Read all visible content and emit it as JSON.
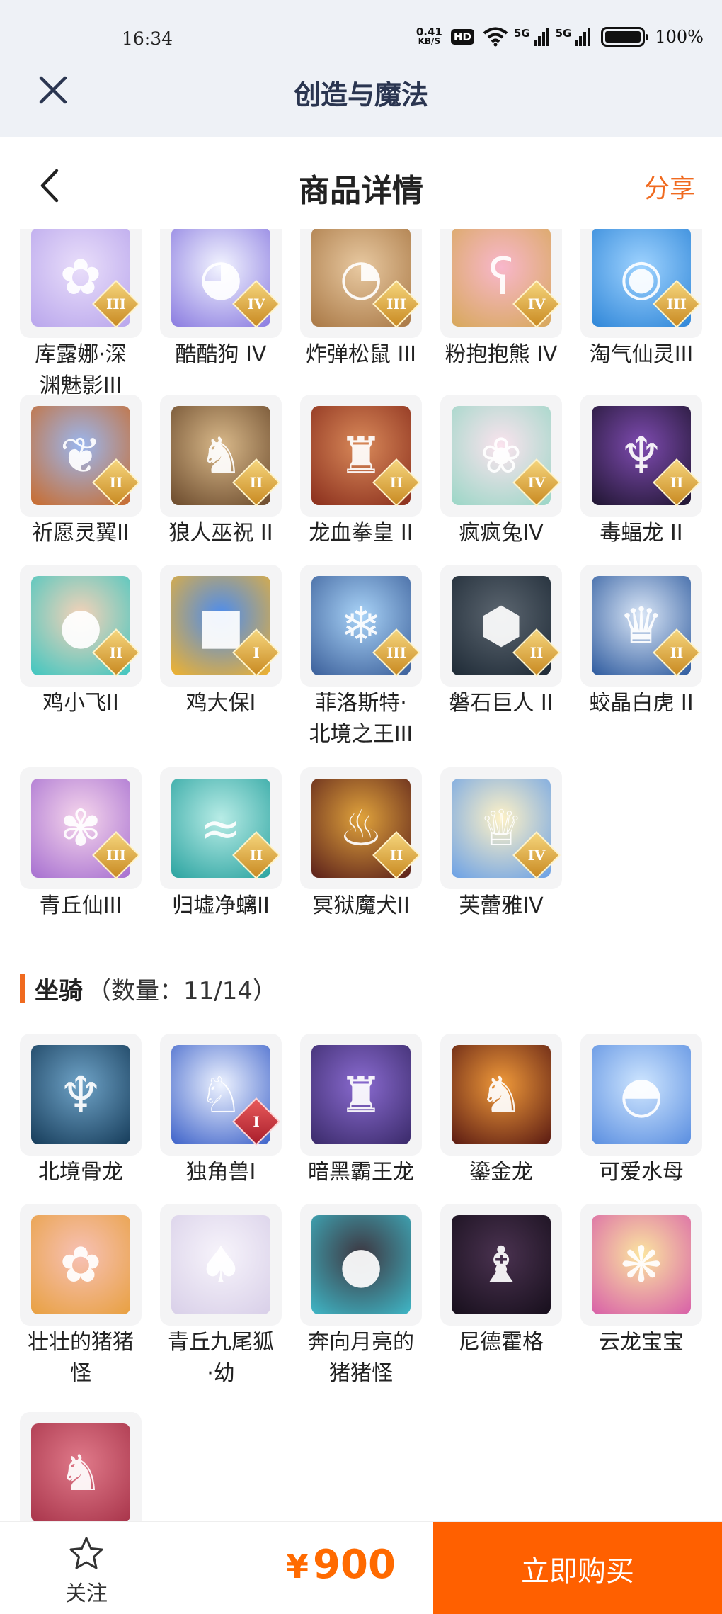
{
  "status_bar": {
    "time": "16:34",
    "net_speed": "0.41",
    "net_speed_unit": "KB/S",
    "hd_badge": "HD",
    "network_1": "5G",
    "network_2": "5G",
    "battery_percent": "100%",
    "battery_level": 1.0
  },
  "app_header": {
    "title": "创造与魔法",
    "close_icon": "close-icon"
  },
  "page_header": {
    "title": "商品详情",
    "share_label": "分享",
    "back_icon": "chevron-left-icon"
  },
  "pets": [
    {
      "name": "库露娜·深\n渊魅影III",
      "rank": "III",
      "colors": [
        "#e9defa",
        "#b9a6ec"
      ],
      "glyph": "✿"
    },
    {
      "name": "酷酷狗 IV",
      "rank": "IV",
      "colors": [
        "#f3f5ff",
        "#8a7be0"
      ],
      "glyph": "◕"
    },
    {
      "name": "炸弹松鼠 III",
      "rank": "III",
      "colors": [
        "#e8c9a1",
        "#a97845"
      ],
      "glyph": "◔"
    },
    {
      "name": "粉抱抱熊 IV",
      "rank": "IV",
      "colors": [
        "#f8b7cc",
        "#d7a85a"
      ],
      "glyph": "ʕ"
    },
    {
      "name": "淘气仙灵III",
      "rank": "III",
      "colors": [
        "#9fd3ff",
        "#2f86d8"
      ],
      "glyph": "◉"
    },
    {
      "name": "祈愿灵翼II",
      "rank": "II",
      "colors": [
        "#9ab7f0",
        "#c96b2c"
      ],
      "glyph": "❦"
    },
    {
      "name": "狼人巫祝 II",
      "rank": "II",
      "colors": [
        "#d9b98a",
        "#6b4a2c"
      ],
      "glyph": "♞"
    },
    {
      "name": "龙血拳皇 II",
      "rank": "II",
      "colors": [
        "#d98a5a",
        "#8a2e1c"
      ],
      "glyph": "♜"
    },
    {
      "name": "疯疯兔IV",
      "rank": "IV",
      "colors": [
        "#fbe3ee",
        "#9ad6c6"
      ],
      "glyph": "❀"
    },
    {
      "name": "毒蝠龙 II",
      "rank": "II",
      "colors": [
        "#7e4bb0",
        "#1f1530"
      ],
      "glyph": "♆"
    },
    {
      "name": "鸡小飞II",
      "rank": "II",
      "colors": [
        "#f6d2b8",
        "#3fc6c0"
      ],
      "glyph": "●"
    },
    {
      "name": "鸡大保I",
      "rank": "I",
      "colors": [
        "#4b8cf0",
        "#f1b22c"
      ],
      "glyph": "■"
    },
    {
      "name": "菲洛斯特·\n北境之王III",
      "rank": "III",
      "colors": [
        "#a9d3f7",
        "#3b5f9a"
      ],
      "glyph": "❄"
    },
    {
      "name": "磐石巨人 II",
      "rank": "II",
      "colors": [
        "#5c6670",
        "#1e2a36"
      ],
      "glyph": "⬢"
    },
    {
      "name": "蛟晶白虎 II",
      "rank": "II",
      "colors": [
        "#dbe7f7",
        "#2d5a9e"
      ],
      "glyph": "♛"
    },
    {
      "name": "青丘仙III",
      "rank": "III",
      "colors": [
        "#f6d6ec",
        "#a66fd0"
      ],
      "glyph": "✾"
    },
    {
      "name": "归墟净螭II",
      "rank": "II",
      "colors": [
        "#b8ece6",
        "#2aa3a0"
      ],
      "glyph": "≈"
    },
    {
      "name": "冥狱魔犬II",
      "rank": "II",
      "colors": [
        "#e0a33c",
        "#5a1f1a"
      ],
      "glyph": "♨"
    },
    {
      "name": "芙蕾雅IV",
      "rank": "IV",
      "colors": [
        "#fff2c6",
        "#6aa0e6"
      ],
      "glyph": "♕"
    }
  ],
  "mounts_section": {
    "title": "坐骑",
    "count_label": "（数量：11/14）"
  },
  "mounts": [
    {
      "name": "北境骨龙",
      "rank": "",
      "colors": [
        "#6fa3c7",
        "#163c5a"
      ],
      "glyph": "♆"
    },
    {
      "name": "独角兽I",
      "rank": "I",
      "colors": [
        "#eef3ff",
        "#3d62c9"
      ],
      "glyph": "♘",
      "rank_style": "red"
    },
    {
      "name": "暗黑霸王龙",
      "rank": "",
      "colors": [
        "#8a6bd0",
        "#3a2a6a"
      ],
      "glyph": "♜"
    },
    {
      "name": "鎏金龙",
      "rank": "",
      "colors": [
        "#f09a3a",
        "#5a1a12"
      ],
      "glyph": "♞"
    },
    {
      "name": "可爱水母",
      "rank": "",
      "colors": [
        "#cfe6ff",
        "#5a8ee0"
      ],
      "glyph": "◓"
    },
    {
      "name": "壮壮的猪猪\n怪",
      "rank": "",
      "colors": [
        "#f7c1b6",
        "#e8a040"
      ],
      "glyph": "✿"
    },
    {
      "name": "青丘九尾狐\n·幼",
      "rank": "",
      "colors": [
        "#f7f4fb",
        "#d8cfe8"
      ],
      "glyph": "♠"
    },
    {
      "name": "奔向月亮的\n猪猪怪",
      "rank": "",
      "colors": [
        "#3d3640",
        "#3fb7c7"
      ],
      "glyph": "●"
    },
    {
      "name": "尼德霍格",
      "rank": "",
      "colors": [
        "#4a3250",
        "#170f1c"
      ],
      "glyph": "♝"
    },
    {
      "name": "云龙宝宝",
      "rank": "",
      "colors": [
        "#fbe6a0",
        "#d85fa8"
      ],
      "glyph": "❋"
    },
    {
      "name": "",
      "rank": "",
      "colors": [
        "#e07a8a",
        "#a8344a"
      ],
      "glyph": "♞"
    }
  ],
  "bottom_bar": {
    "follow_label": "关注",
    "currency": "¥",
    "price": "900",
    "buy_label": "立即购买"
  },
  "colors": {
    "accent": "#f06a1f",
    "buy_button": "#ff6000",
    "price": "#ff6a00"
  }
}
